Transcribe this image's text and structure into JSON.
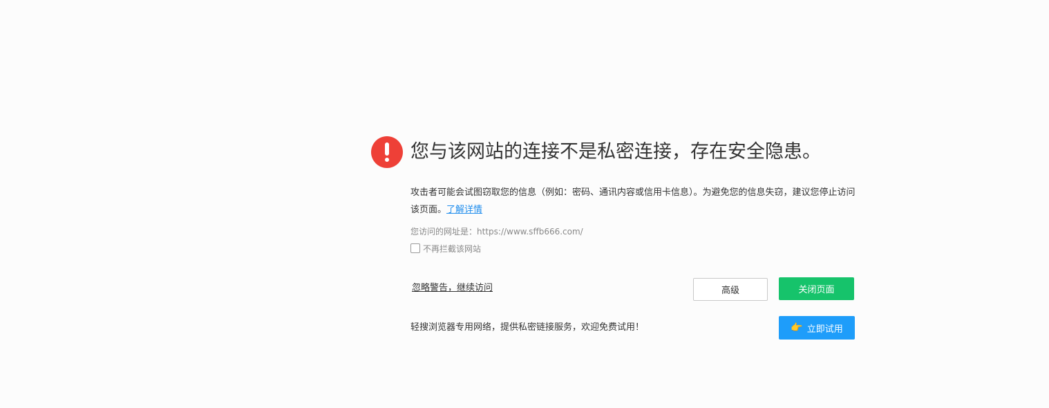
{
  "warning": {
    "title": "您与该网站的连接不是私密连接，存在安全隐患。",
    "description": "攻击者可能会试图窃取您的信息（例如：密码、通讯内容或信用卡信息）。为避免您的信息失窃，建议您停止访问该页面。",
    "learn_more": "了解详情",
    "url_label": "您访问的网址是：",
    "url": "https://www.sffb666.com/",
    "no_block_label": "不再拦截该网站",
    "no_block_checked": false
  },
  "actions": {
    "ignore_link": "忽略警告，继续访问",
    "advanced_label": "高级",
    "close_label": "关闭页面"
  },
  "promo": {
    "text": "轻搜浏览器专用网络，提供私密链接服务，欢迎免费试用！",
    "try_label": "立即试用",
    "try_icon": "pointing-hand-icon"
  },
  "colors": {
    "warning_red": "#ee4037",
    "link_blue": "#1f8ded",
    "close_green": "#16c36b",
    "try_blue": "#1e9dfa"
  }
}
